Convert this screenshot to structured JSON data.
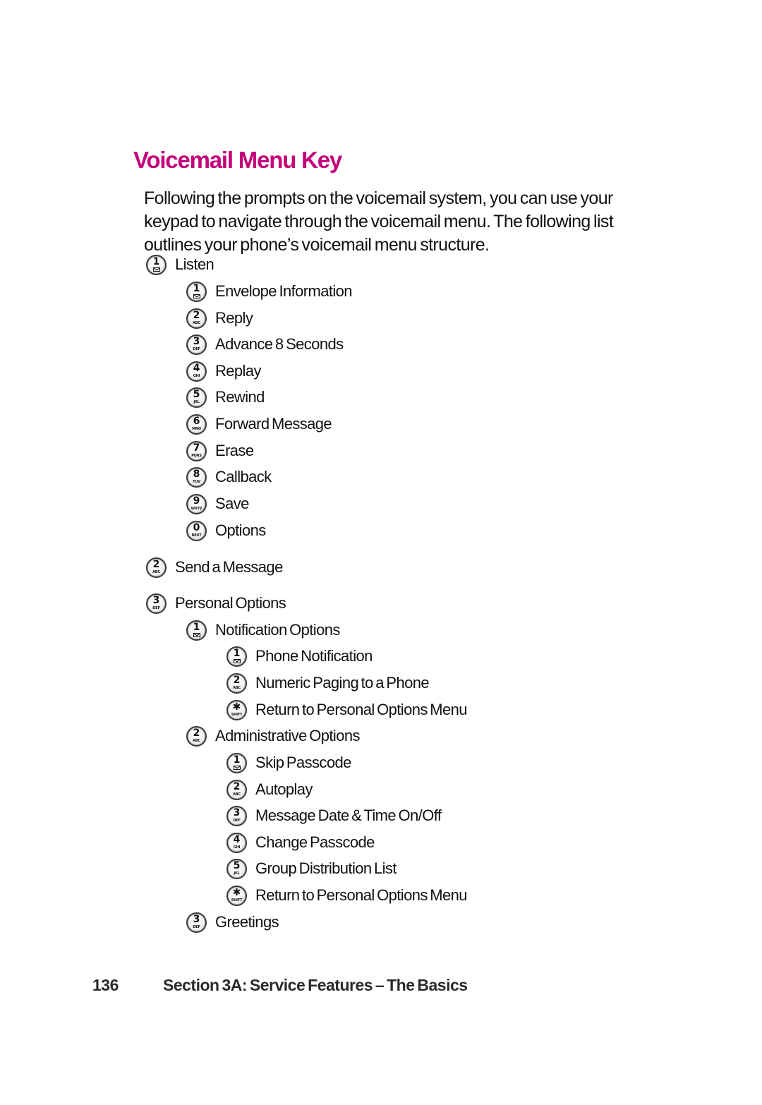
{
  "page": {
    "title": "Voicemail Menu Key",
    "title_color": "#c4007a",
    "intro": "Following the prompts on the voicemail system, you can use your keypad to navigate through the voicemail menu. The following list outlines your phone’s voicemail menu structure."
  },
  "keys": {
    "1": {
      "digit": "1",
      "sub": "",
      "icon": "envelope-icon"
    },
    "2": {
      "digit": "2",
      "sub": "ABC",
      "icon": "key-2-icon"
    },
    "3": {
      "digit": "3",
      "sub": "DEF",
      "icon": "key-3-icon"
    },
    "4": {
      "digit": "4",
      "sub": "GHI",
      "icon": "key-4-icon"
    },
    "5": {
      "digit": "5",
      "sub": "JKL",
      "icon": "key-5-icon"
    },
    "6": {
      "digit": "6",
      "sub": "MNO",
      "icon": "key-6-icon"
    },
    "7": {
      "digit": "7",
      "sub": "PQRS",
      "icon": "key-7-icon"
    },
    "8": {
      "digit": "8",
      "sub": "TUV",
      "icon": "key-8-icon"
    },
    "9": {
      "digit": "9",
      "sub": "WXYZ",
      "icon": "key-9-icon"
    },
    "0": {
      "digit": "0",
      "sub": "NEXT",
      "icon": "key-0-icon"
    },
    "*": {
      "digit": "✱",
      "sub": "SHIFT",
      "icon": "key-star-icon"
    }
  },
  "menu": [
    {
      "level": 0,
      "key": "1",
      "label": "Listen"
    },
    {
      "level": 1,
      "key": "1",
      "label": "Envelope Information"
    },
    {
      "level": 1,
      "key": "2",
      "label": "Reply"
    },
    {
      "level": 1,
      "key": "3",
      "label": "Advance 8 Seconds"
    },
    {
      "level": 1,
      "key": "4",
      "label": "Replay"
    },
    {
      "level": 1,
      "key": "5",
      "label": "Rewind"
    },
    {
      "level": 1,
      "key": "6",
      "label": "Forward Message"
    },
    {
      "level": 1,
      "key": "7",
      "label": "Erase"
    },
    {
      "level": 1,
      "key": "8",
      "label": "Callback"
    },
    {
      "level": 1,
      "key": "9",
      "label": "Save"
    },
    {
      "level": 1,
      "key": "0",
      "label": "Options"
    },
    {
      "level": 0,
      "key": "2",
      "label": "Send a Message"
    },
    {
      "level": 0,
      "key": "3",
      "label": "Personal Options"
    },
    {
      "level": 1,
      "key": "1",
      "label": "Notification Options"
    },
    {
      "level": 2,
      "key": "1",
      "label": "Phone Notification"
    },
    {
      "level": 2,
      "key": "2",
      "label": "Numeric Paging to a Phone"
    },
    {
      "level": 2,
      "key": "*",
      "label": "Return to Personal Options Menu"
    },
    {
      "level": 1,
      "key": "2",
      "label": "Administrative Options"
    },
    {
      "level": 2,
      "key": "1",
      "label": "Skip Passcode"
    },
    {
      "level": 2,
      "key": "2",
      "label": "Autoplay"
    },
    {
      "level": 2,
      "key": "3",
      "label": "Message Date & Time On/Off"
    },
    {
      "level": 2,
      "key": "4",
      "label": "Change Passcode"
    },
    {
      "level": 2,
      "key": "5",
      "label": "Group Distribution List"
    },
    {
      "level": 2,
      "key": "*",
      "label": "Return to Personal Options Menu"
    },
    {
      "level": 1,
      "key": "3",
      "label": "Greetings"
    }
  ],
  "footer": {
    "page_number": "136",
    "section": "Section 3A: Service Features – The Basics"
  }
}
